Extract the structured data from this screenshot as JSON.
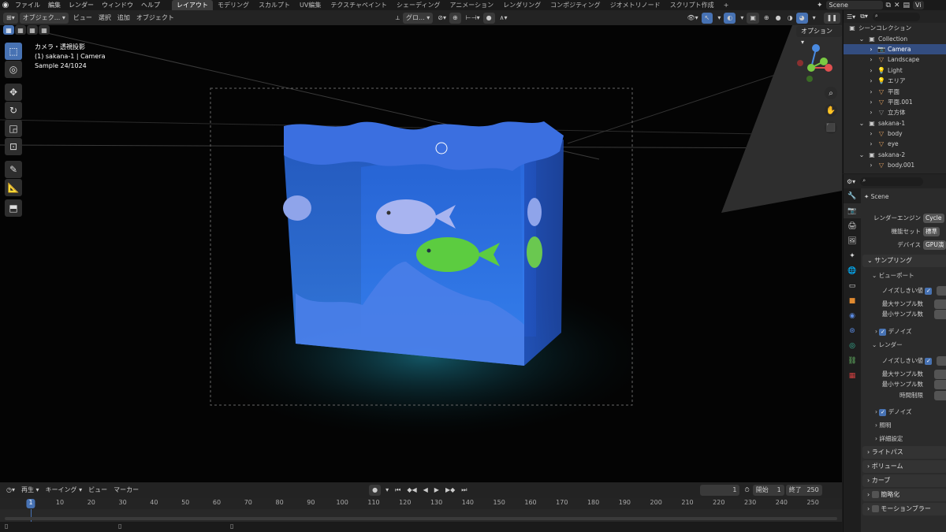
{
  "topbar": {
    "menus": [
      "ファイル",
      "編集",
      "レンダー",
      "ウィンドウ",
      "ヘルプ"
    ],
    "workspaces": [
      "レイアウト",
      "モデリング",
      "スカルプト",
      "UV編集",
      "テクスチャペイント",
      "シェーディング",
      "アニメーション",
      "レンダリング",
      "コンポジティング",
      "ジオメトリノード",
      "スクリプト作成"
    ],
    "scene_label": "Scene",
    "view_layer_label": "Vi"
  },
  "viewport_header": {
    "mode": "オブジェク...",
    "menus": [
      "ビュー",
      "選択",
      "追加",
      "オブジェクト"
    ],
    "orientation": "グロ...",
    "options": "オプション"
  },
  "viewport_overlay": {
    "view_name": "カメラ・透視投影",
    "object_info": "(1) sakana-1 | Camera",
    "sample_info": "Sample 24/1024"
  },
  "outliner": {
    "title": "シーンコレクション",
    "items": [
      {
        "label": "Collection",
        "indent": 1,
        "icon": "collection-icon",
        "color": "#cccccc"
      },
      {
        "label": "Camera",
        "indent": 2,
        "icon": "camera-icon",
        "color": "#e0a060",
        "selected": true
      },
      {
        "label": "Landscape",
        "indent": 2,
        "icon": "mesh-icon",
        "color": "#e0a060"
      },
      {
        "label": "Light",
        "indent": 2,
        "icon": "light-icon",
        "color": "#e0a060"
      },
      {
        "label": "エリア",
        "indent": 2,
        "icon": "light-icon",
        "color": "#e0a060"
      },
      {
        "label": "平面",
        "indent": 2,
        "icon": "mesh-icon",
        "color": "#e0a060"
      },
      {
        "label": "平面.001",
        "indent": 2,
        "icon": "mesh-icon",
        "color": "#e0a060"
      },
      {
        "label": "立方体",
        "indent": 2,
        "icon": "mesh-icon",
        "color": "#888888"
      },
      {
        "label": "sakana-1",
        "indent": 1,
        "icon": "collection-icon",
        "color": "#cccccc"
      },
      {
        "label": "body",
        "indent": 2,
        "icon": "mesh-icon",
        "color": "#e0a060"
      },
      {
        "label": "eye",
        "indent": 2,
        "icon": "mesh-icon",
        "color": "#e0a060"
      },
      {
        "label": "sakana-2",
        "indent": 1,
        "icon": "collection-icon",
        "color": "#cccccc"
      },
      {
        "label": "body.001",
        "indent": 2,
        "icon": "mesh-icon",
        "color": "#e0a060"
      }
    ]
  },
  "properties": {
    "context": "Scene",
    "render_engine_label": "レンダーエンジン",
    "render_engine_value": "Cycle",
    "feature_set_label": "機能セット",
    "feature_set_value": "標準",
    "device_label": "デバイス",
    "device_value": "GPU演",
    "sampling": "サンプリング",
    "viewport": "ビューポート",
    "noise_threshold": "ノイズしきい値",
    "max_samples": "最大サンプル数",
    "min_samples": "最小サンプル数",
    "denoise": "デノイズ",
    "render": "レンダー",
    "time_limit": "時間制限",
    "lighting": "照明",
    "advanced": "詳細設定",
    "light_paths": "ライトパス",
    "volumes": "ボリューム",
    "curves": "カーブ",
    "simplify": "簡略化",
    "motion_blur": "モーションブラー"
  },
  "timeline": {
    "playback": "再生",
    "keying": "キーイング",
    "view": "ビュー",
    "marker": "マーカー",
    "current_frame": "1",
    "start_label": "開始",
    "start_value": "1",
    "end_label": "終了",
    "end_value": "250",
    "ticks": [
      "10",
      "20",
      "30",
      "40",
      "50",
      "60",
      "70",
      "80",
      "90",
      "100",
      "110",
      "120",
      "130",
      "140",
      "150",
      "160",
      "170",
      "180",
      "190",
      "200",
      "210",
      "220",
      "230",
      "240",
      "250"
    ],
    "current_marker": "1"
  }
}
